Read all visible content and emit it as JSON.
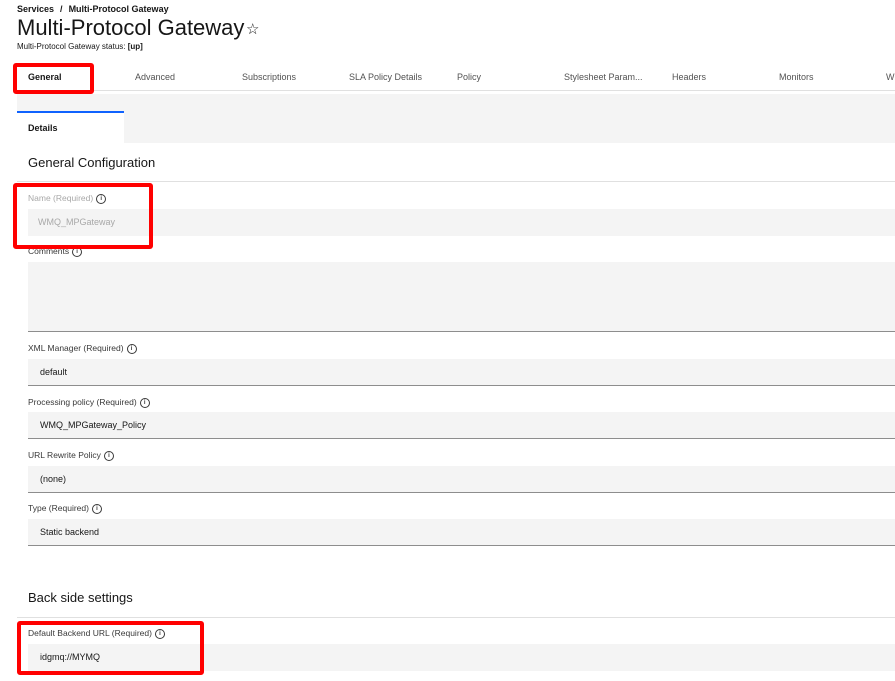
{
  "breadcrumb": {
    "parent": "Services",
    "separator": "/",
    "current": "Multi-Protocol Gateway"
  },
  "header": {
    "title": "Multi-Protocol Gateway",
    "star_glyph": "☆",
    "status_label": "Multi-Protocol Gateway status:",
    "status_value": "[up]"
  },
  "tabs": [
    {
      "label": "General",
      "active": true
    },
    {
      "label": "Advanced"
    },
    {
      "label": "Subscriptions"
    },
    {
      "label": "SLA Policy Details"
    },
    {
      "label": "Policy"
    },
    {
      "label": "Stylesheet Param..."
    },
    {
      "label": "Headers"
    },
    {
      "label": "Monitors"
    },
    {
      "label": "W"
    }
  ],
  "subtab": {
    "label": "Details"
  },
  "general_config": {
    "title": "General Configuration",
    "name": {
      "label": "Name (Required)",
      "value": "WMQ_MPGateway"
    },
    "comments": {
      "label": "Comments",
      "value": ""
    },
    "xml_manager": {
      "label": "XML Manager (Required)",
      "value": "default"
    },
    "processing_policy": {
      "label": "Processing policy (Required)",
      "value": "WMQ_MPGateway_Policy"
    },
    "url_rewrite": {
      "label": "URL Rewrite Policy",
      "value": "(none)"
    },
    "type": {
      "label": "Type (Required)",
      "value": "Static backend"
    }
  },
  "back_side": {
    "title": "Back side settings",
    "backend_url": {
      "label": "Default Backend URL (Required)",
      "value": "idgmq://MYMQ"
    }
  },
  "info_glyph": "i",
  "colors": {
    "highlight": "#ff0000",
    "accent": "#0f62fe"
  }
}
